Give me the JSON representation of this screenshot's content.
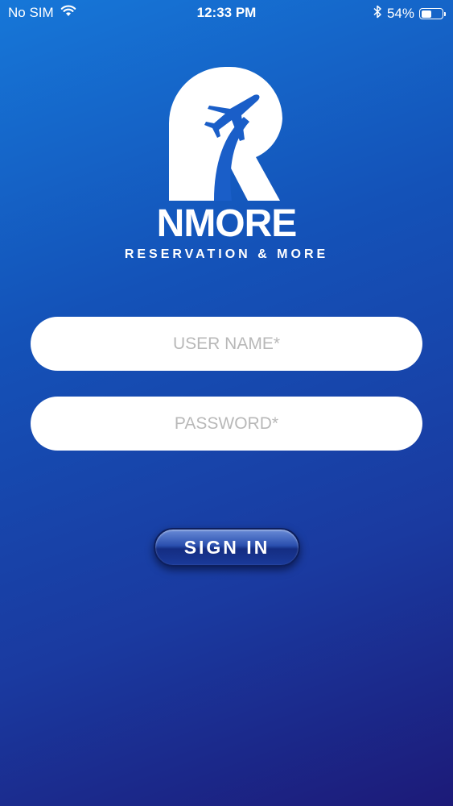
{
  "status_bar": {
    "carrier": "No SIM",
    "time": "12:33 PM",
    "battery_percent": "54%",
    "battery_level": 0.54,
    "icons": [
      "wifi-icon",
      "bluetooth-icon",
      "battery-icon"
    ]
  },
  "brand": {
    "logo_letter": "R",
    "name": "NMORE",
    "tagline": "RESERVATION & MORE"
  },
  "login_form": {
    "username_placeholder": "USER NAME*",
    "username_value": "",
    "password_placeholder": "PASSWORD*",
    "password_value": "",
    "signin_label": "SIGN IN"
  },
  "colors": {
    "background_top": "#1677d8",
    "background_bottom": "#1c1a78",
    "button_dark": "#142d82",
    "field_bg": "#ffffff",
    "placeholder": "#b8b8b8"
  }
}
